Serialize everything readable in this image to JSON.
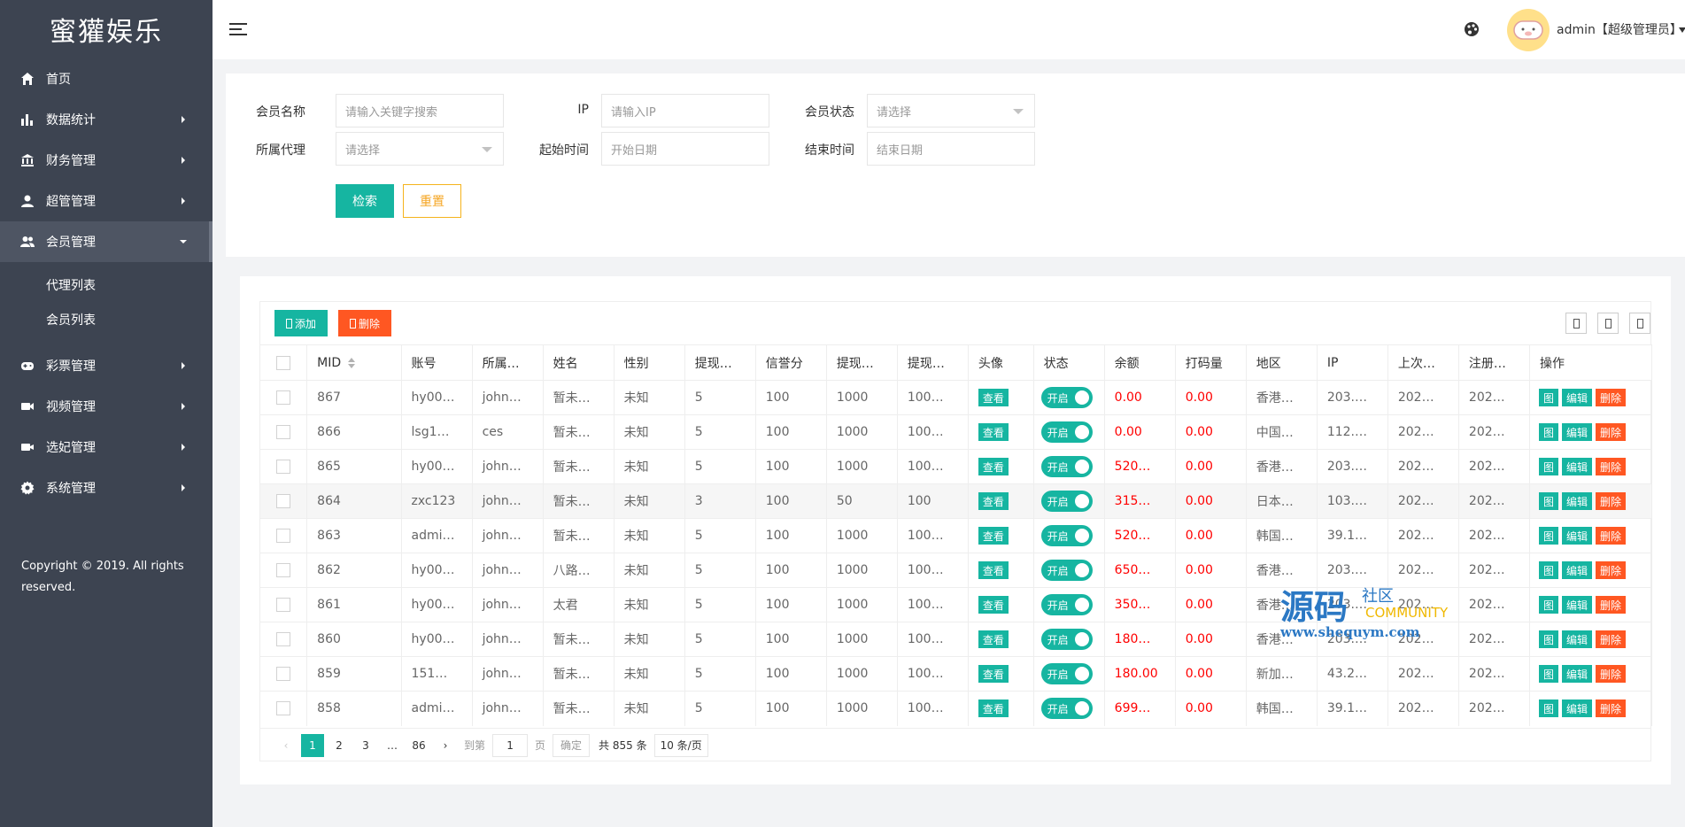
{
  "app": {
    "logo": "蜜獾娱乐"
  },
  "sidebar": {
    "items": [
      {
        "label": "首页",
        "icon": "home-icon",
        "has_chevron": false
      },
      {
        "label": "数据统计",
        "icon": "bar-chart-icon",
        "has_chevron": true
      },
      {
        "label": "财务管理",
        "icon": "bank-icon",
        "has_chevron": true
      },
      {
        "label": "超管管理",
        "icon": "user-icon",
        "has_chevron": true
      },
      {
        "label": "会员管理",
        "icon": "users-icon",
        "has_chevron": true,
        "active": true
      },
      {
        "label": "彩票管理",
        "icon": "gamepad-icon",
        "has_chevron": true
      },
      {
        "label": "视频管理",
        "icon": "video-icon",
        "has_chevron": true
      },
      {
        "label": "选妃管理",
        "icon": "camera-icon",
        "has_chevron": true
      },
      {
        "label": "系统管理",
        "icon": "gear-icon",
        "has_chevron": true
      }
    ],
    "submenu": [
      "代理列表",
      "会员列表"
    ],
    "copyright": "Copyright © 2019. All rights reserved."
  },
  "header": {
    "user": "admin【超级管理员】"
  },
  "search": {
    "member_name_label": "会员名称",
    "member_name_placeholder": "请输入关键字搜索",
    "ip_label": "IP",
    "ip_placeholder": "请输入IP",
    "status_label": "会员状态",
    "status_placeholder": "请选择",
    "agent_label": "所属代理",
    "agent_placeholder": "请选择",
    "start_label": "起始时间",
    "start_placeholder": "开始日期",
    "end_label": "结束时间",
    "end_placeholder": "结束日期",
    "search_btn": "检索",
    "reset_btn": "重置"
  },
  "toolbar": {
    "add_label": "添加",
    "delete_label": "删除"
  },
  "table": {
    "headers": [
      "MID",
      "账号",
      "所属…",
      "姓名",
      "性别",
      "提现…",
      "信誉分",
      "提现…",
      "提现…",
      "头像",
      "状态",
      "余额",
      "打码量",
      "地区",
      "IP",
      "上次…",
      "注册…",
      "操作"
    ],
    "view_label": "查看",
    "switch_label": "开启",
    "action_qr": "图",
    "action_edit": "编辑",
    "action_delete": "删除",
    "rows": [
      {
        "mid": "867",
        "account": "hy00…",
        "agent": "john…",
        "name": "暂未…",
        "gender": "未知",
        "w1": "5",
        "credit": "100",
        "w2": "1000",
        "w3": "100…",
        "balance": "0.00",
        "bet": "0.00",
        "region": "香港…",
        "ip": "203.…",
        "last": "202…",
        "reg": "202…"
      },
      {
        "mid": "866",
        "account": "lsg1…",
        "agent": "ces",
        "name": "暂未…",
        "gender": "未知",
        "w1": "5",
        "credit": "100",
        "w2": "1000",
        "w3": "100…",
        "balance": "0.00",
        "bet": "0.00",
        "region": "中国…",
        "ip": "112.…",
        "last": "202…",
        "reg": "202…"
      },
      {
        "mid": "865",
        "account": "hy00…",
        "agent": "john…",
        "name": "暂未…",
        "gender": "未知",
        "w1": "5",
        "credit": "100",
        "w2": "1000",
        "w3": "100…",
        "balance": "520…",
        "bet": "0.00",
        "region": "香港…",
        "ip": "203.…",
        "last": "202…",
        "reg": "202…"
      },
      {
        "mid": "864",
        "account": "zxc123",
        "agent": "john…",
        "name": "暂未…",
        "gender": "未知",
        "w1": "3",
        "credit": "100",
        "w2": "50",
        "w3": "100",
        "balance": "315…",
        "bet": "0.00",
        "region": "日本…",
        "ip": "103.…",
        "last": "202…",
        "reg": "202…",
        "highlight": true
      },
      {
        "mid": "863",
        "account": "admi…",
        "agent": "john…",
        "name": "暂未…",
        "gender": "未知",
        "w1": "5",
        "credit": "100",
        "w2": "1000",
        "w3": "100…",
        "balance": "520…",
        "bet": "0.00",
        "region": "韩国…",
        "ip": "39.1…",
        "last": "202…",
        "reg": "202…"
      },
      {
        "mid": "862",
        "account": "hy00…",
        "agent": "john…",
        "name": "八路…",
        "gender": "未知",
        "w1": "5",
        "credit": "100",
        "w2": "1000",
        "w3": "100…",
        "balance": "650…",
        "bet": "0.00",
        "region": "香港…",
        "ip": "203.…",
        "last": "202…",
        "reg": "202…"
      },
      {
        "mid": "861",
        "account": "hy00…",
        "agent": "john…",
        "name": "太君",
        "gender": "未知",
        "w1": "5",
        "credit": "100",
        "w2": "1000",
        "w3": "100…",
        "balance": "350…",
        "bet": "0.00",
        "region": "香港…",
        "ip": "203.…",
        "last": "202…",
        "reg": "202…"
      },
      {
        "mid": "860",
        "account": "hy00…",
        "agent": "john…",
        "name": "暂未…",
        "gender": "未知",
        "w1": "5",
        "credit": "100",
        "w2": "1000",
        "w3": "100…",
        "balance": "180…",
        "bet": "0.00",
        "region": "香港…",
        "ip": "203.…",
        "last": "202…",
        "reg": "202…"
      },
      {
        "mid": "859",
        "account": "151…",
        "agent": "john…",
        "name": "暂未…",
        "gender": "未知",
        "w1": "5",
        "credit": "100",
        "w2": "1000",
        "w3": "100…",
        "balance": "180.00",
        "bet": "0.00",
        "region": "新加…",
        "ip": "43.2…",
        "last": "202…",
        "reg": "202…"
      },
      {
        "mid": "858",
        "account": "admi…",
        "agent": "john…",
        "name": "暂未…",
        "gender": "未知",
        "w1": "5",
        "credit": "100",
        "w2": "1000",
        "w3": "100…",
        "balance": "699…",
        "bet": "0.00",
        "region": "韩国…",
        "ip": "39.1…",
        "last": "202…",
        "reg": "202…"
      }
    ]
  },
  "pager": {
    "pages": [
      "1",
      "2",
      "3",
      "…",
      "86"
    ],
    "goto_label": "到第",
    "goto_value": "1",
    "page_suffix": "页",
    "confirm": "确定",
    "total": "共 855 条",
    "page_size": "10 条/页"
  },
  "watermark": {
    "big": "源码",
    "small": "社区",
    "eng": "COMMUNITY",
    "url": "www.shequym.com"
  },
  "colors": {
    "primary": "#16b5a1",
    "danger": "#ff5722",
    "sidebar": "#3d4451"
  }
}
